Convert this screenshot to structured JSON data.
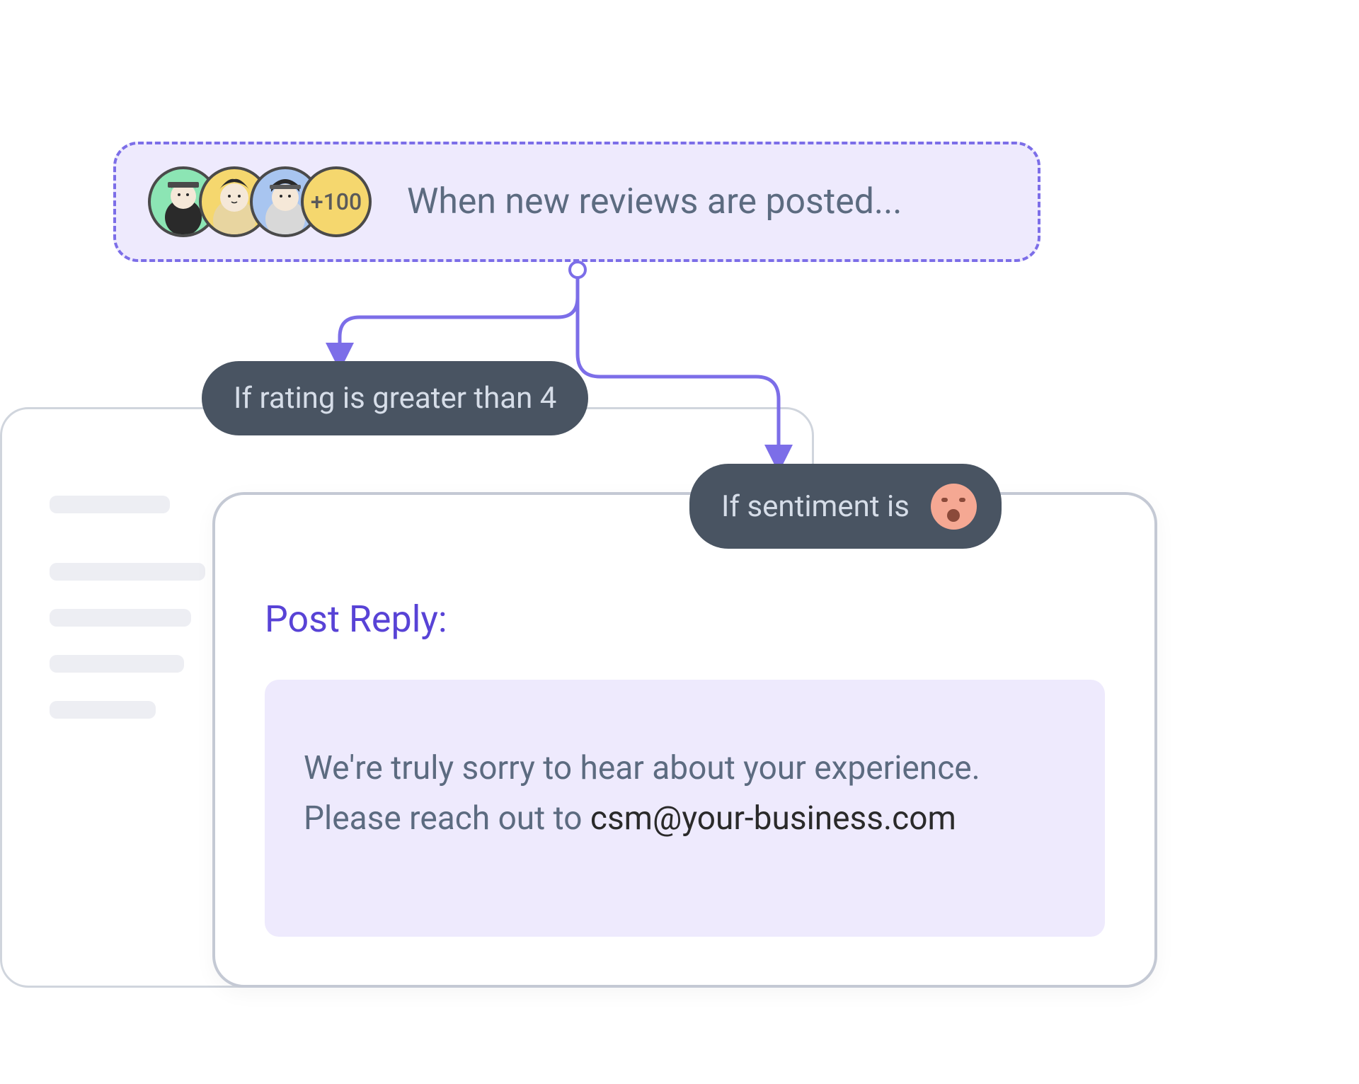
{
  "trigger": {
    "label": "When new reviews are posted...",
    "avatar_count_label": "+100"
  },
  "conditions": {
    "rating": "If rating is greater than 4",
    "sentiment": "If sentiment is"
  },
  "reply": {
    "title": "Post Reply:",
    "body_prefix": "We're truly sorry to hear about your experience. Please reach out to ",
    "email": "csm@your-business.com"
  },
  "colors": {
    "accent": "#7c6ee8",
    "pill_bg": "#495462",
    "soft_bg": "#eeeafd"
  }
}
